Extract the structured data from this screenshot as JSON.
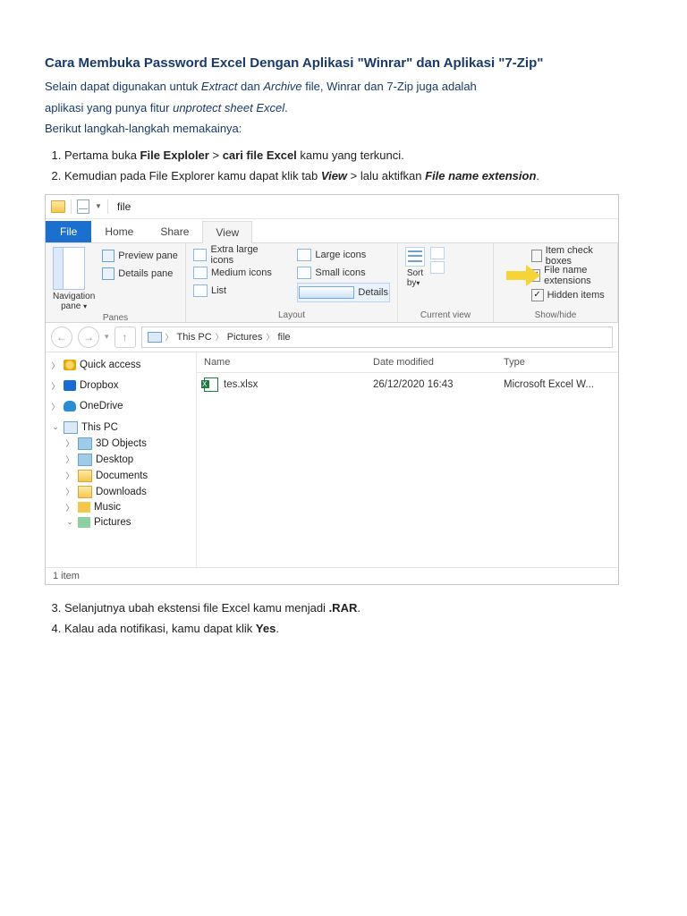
{
  "title": "Cara Membuka Password Excel Dengan Aplikasi \"Winrar\" dan Aplikasi \"7-Zip\"",
  "intro": {
    "line1_a": "Selain dapat digunakan untuk ",
    "line1_i1": "Extract",
    "line1_mid": " dan ",
    "line1_i2": "Archive",
    "line1_b": " file, Winrar dan 7-Zip juga adalah",
    "line2_a": "aplikasi yang punya fitur ",
    "line2_i": "unprotect sheet Excel",
    "line2_b": ".",
    "line3": "Berikut langkah-langkah memakainya:"
  },
  "steps": {
    "s1_a": "Pertama buka ",
    "s1_b1": "File Exploler",
    "s1_mid": " > ",
    "s1_b2": "cari file Excel",
    "s1_c": " kamu yang terkunci.",
    "s2_a": "Kemudian pada File Explorer kamu dapat klik tab ",
    "s2_b1": "View",
    "s2_mid": " > lalu aktifkan ",
    "s2_b2": "File name extension",
    "s2_c": ".",
    "s3_a": "Selanjutnya ubah ekstensi file Excel kamu menjadi ",
    "s3_b": ".RAR",
    "s3_c": ".",
    "s4_a": "Kalau ada notifikasi, kamu dapat klik ",
    "s4_b": "Yes",
    "s4_c": "."
  },
  "explorer": {
    "titlebar": {
      "sep": "|",
      "label": "file"
    },
    "tabs": {
      "file": "File",
      "home": "Home",
      "share": "Share",
      "view": "View"
    },
    "ribbon": {
      "panes": {
        "nav": "Navigation",
        "nav2": "pane",
        "preview": "Preview pane",
        "details": "Details pane",
        "label": "Panes"
      },
      "layout": {
        "xl": "Extra large icons",
        "lg": "Large icons",
        "md": "Medium icons",
        "sm": "Small icons",
        "list": "List",
        "det": "Details",
        "label": "Layout"
      },
      "current": {
        "sort": "Sort",
        "by": "by",
        "label": "Current view"
      },
      "show": {
        "item_cb": "Item check boxes",
        "fne": "File name extensions",
        "hidden": "Hidden items",
        "label": "Show/hide"
      }
    },
    "address": {
      "thispc": "This PC",
      "pictures": "Pictures",
      "file": "file"
    },
    "columns": {
      "name": "Name",
      "date": "Date modified",
      "type": "Type"
    },
    "row": {
      "name": "tes.xlsx",
      "date": "26/12/2020 16:43",
      "type": "Microsoft Excel W..."
    },
    "sidebar": {
      "quick": "Quick access",
      "dropbox": "Dropbox",
      "onedrive": "OneDrive",
      "thispc": "This PC",
      "threeD": "3D Objects",
      "desktop": "Desktop",
      "documents": "Documents",
      "downloads": "Downloads",
      "music": "Music",
      "pictures": "Pictures"
    },
    "status": "1 item"
  }
}
